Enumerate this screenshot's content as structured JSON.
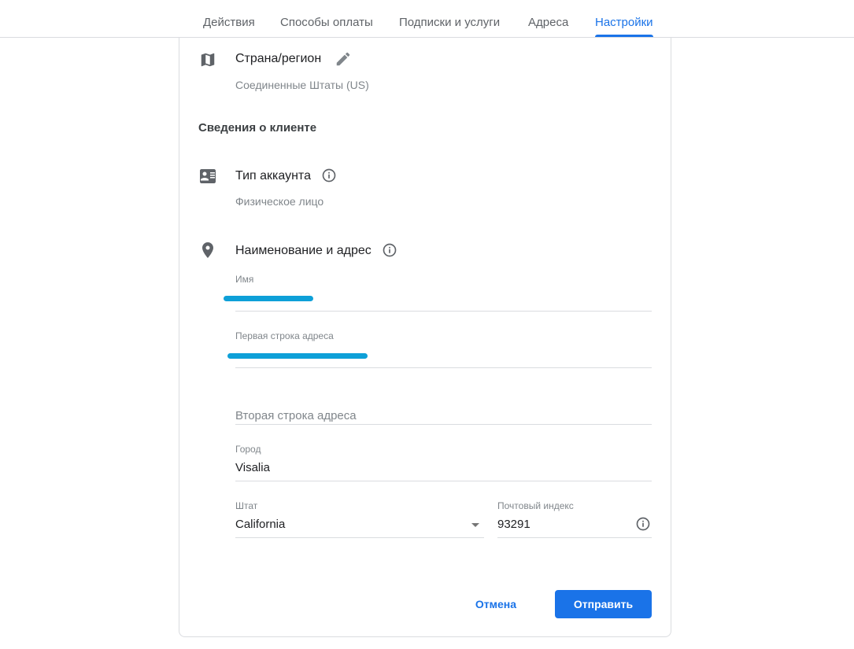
{
  "tabs": [
    {
      "label": "Действия"
    },
    {
      "label": "Способы оплаты"
    },
    {
      "label": "Подписки и услуги"
    },
    {
      "label": "Адреса"
    },
    {
      "label": "Настройки",
      "active": true
    }
  ],
  "country": {
    "title": "Страна/регион",
    "value": "Соединенные Штаты (US)"
  },
  "customer_section": "Сведения о клиенте",
  "account_type": {
    "title": "Тип аккаунта",
    "value": "Физическое лицо"
  },
  "name_address": {
    "title": "Наименование и адрес",
    "name": {
      "label": "Имя",
      "value": ""
    },
    "address1": {
      "label": "Первая строка адреса",
      "value": ""
    },
    "address2": {
      "placeholder": "Вторая строка адреса"
    },
    "city": {
      "label": "Город",
      "value": "Visalia"
    },
    "state": {
      "label": "Штат",
      "value": "California"
    },
    "zip": {
      "label": "Почтовый индекс",
      "value": "93291"
    }
  },
  "buttons": {
    "cancel": "Отмена",
    "submit": "Отправить"
  },
  "colors": {
    "accent": "#1a73e8",
    "redaction": "#0ea0d8"
  }
}
